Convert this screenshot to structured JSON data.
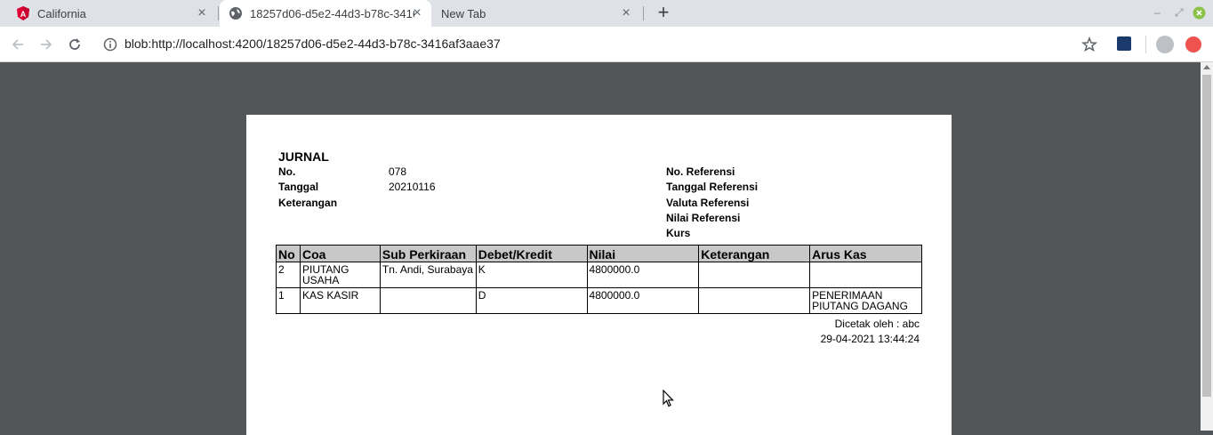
{
  "browser": {
    "tabs": [
      {
        "label": "California",
        "icon": "angular-icon"
      },
      {
        "label": "18257d06-d5e2-44d3-b78c-3416af3aae37",
        "icon": "globe-icon"
      },
      {
        "label": "New Tab",
        "icon": ""
      }
    ],
    "url": "blob:http://localhost:4200/18257d06-d5e2-44d3-b78c-3416af3aae37"
  },
  "doc": {
    "title": "JURNAL",
    "left_fields": [
      {
        "label": "No.",
        "value": "078"
      },
      {
        "label": "Tanggal",
        "value": "20210116"
      },
      {
        "label": "Keterangan",
        "value": ""
      }
    ],
    "right_fields": [
      {
        "label": "No. Referensi"
      },
      {
        "label": "Tanggal Referensi"
      },
      {
        "label": "Valuta Referensi"
      },
      {
        "label": "Nilai Referensi"
      },
      {
        "label": "Kurs"
      }
    ],
    "table": {
      "headers": [
        "No",
        "Coa",
        "Sub Perkiraan",
        "Debet/Kredit",
        "Nilai",
        "Keterangan",
        "Arus Kas"
      ],
      "rows": [
        [
          "2",
          "PIUTANG USAHA",
          "Tn. Andi, Surabaya",
          "K",
          "4800000.0",
          "",
          ""
        ],
        [
          "1",
          "KAS KASIR",
          "",
          "D",
          "4800000.0",
          "",
          "PENERIMAAN PIUTANG DAGANG"
        ]
      ]
    },
    "printed_by": "Dicetak oleh : abc",
    "printed_at": "29-04-2021 13:44:24"
  },
  "colors": {
    "tabstrip": "#dee1e6",
    "viewer_bg": "#525659",
    "table_header": "#c8c8c8"
  }
}
